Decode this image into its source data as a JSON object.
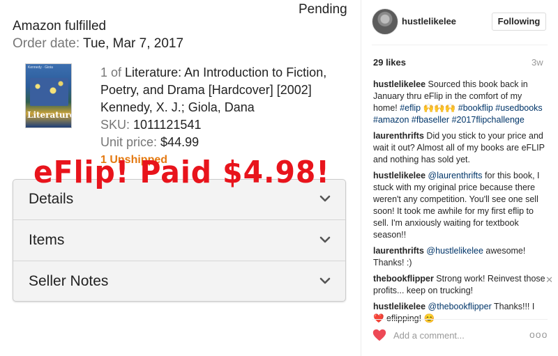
{
  "order": {
    "status": "Pending",
    "fulfillment": "Amazon fulfilled",
    "date_label": "Order date:",
    "date_value": "Tue, Mar 7, 2017"
  },
  "item": {
    "cover_title": "Literature",
    "cover_authors": "Kennedy · Gioia",
    "count_prefix": "1 of",
    "title_line1": "Literature: An Introduction to Fiction,",
    "title_line2": "Poetry, and Drama [Hardcover] [2002]",
    "authors": "Kennedy, X. J.; Giola, Dana",
    "sku_label": "SKU:",
    "sku_value": "1011121541",
    "price_label": "Unit price:",
    "price_value": "$44.99",
    "unshipped": "1 Unshipped"
  },
  "overlay_text": "eFlip! Paid $4.98!",
  "accordion": [
    {
      "label": "Details",
      "icon": "chevron-down-icon"
    },
    {
      "label": "Items",
      "icon": "chevron-down-icon"
    },
    {
      "label": "Seller Notes",
      "icon": "chevron-down-icon"
    }
  ],
  "post": {
    "username": "hustlelikelee",
    "follow_label": "Following",
    "likes": "29 likes",
    "time_ago": "3w",
    "caption": {
      "user": "hustlelikelee",
      "text": "Sourced this book back in January thru eFlip in the comfort of my home!",
      "tags": "#eflip 🙌🙌🙌 #bookflip #usedbooks #amazon #fbaseller #2017flipchallenge"
    },
    "comments": [
      {
        "user": "laurenthrifts",
        "text": "Did you stick to your price and wait it out? Almost all of my books are eFLIP and nothing has sold yet."
      },
      {
        "user": "hustlelikelee",
        "mention": "@laurenthrifts",
        "text": "for this book, I stuck with my original price because there weren't any competition. You'll see one sell soon! It took me awhile for my first eflip to sell. I'm anxiously waiting for textbook season!!"
      },
      {
        "user": "laurenthrifts",
        "mention": "@hustlelikelee",
        "text": "awesome! Thanks! :)"
      },
      {
        "user": "thebookflipper",
        "text": "Strong work! Reinvest those profits... keep on trucking!"
      },
      {
        "user": "hustlelikelee",
        "mention": "@thebookflipper",
        "text": "Thanks!!! I ❤️ eflipping! 😊"
      }
    ],
    "add_comment_placeholder": "Add a comment...",
    "more_label": "ooo",
    "accent_color": "#ed4956",
    "link_color": "#003569"
  }
}
